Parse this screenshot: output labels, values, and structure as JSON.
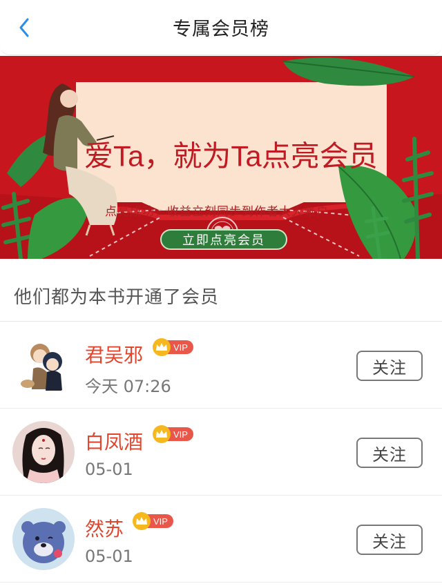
{
  "header": {
    "title": "专属会员榜"
  },
  "banner": {
    "title": "爱Ta，就为Ta点亮会员",
    "subtitle": "点亮成功，收益立刻同步到作者大大账户",
    "button_label": "立即点亮会员"
  },
  "section": {
    "heading": "他们都为本书开通了会员"
  },
  "members": [
    {
      "name": "君吴邪",
      "vip_label": "VIP",
      "time": "今天 07:26",
      "follow_label": "关注"
    },
    {
      "name": "白凤酒",
      "vip_label": "VIP",
      "time": "05-01",
      "follow_label": "关注"
    },
    {
      "name": "然苏",
      "vip_label": "VIP",
      "time": "05-01",
      "follow_label": "关注"
    }
  ],
  "colors": {
    "accent_blue": "#2a8ee8",
    "banner_red": "#c8161e",
    "name_red": "#e2452c",
    "vip_gold": "#f6b81f",
    "button_green": "#2f7d3a"
  },
  "icons": {
    "back": "chevron-left-icon",
    "crown": "crown-icon",
    "heart": "heart-seal-icon"
  }
}
